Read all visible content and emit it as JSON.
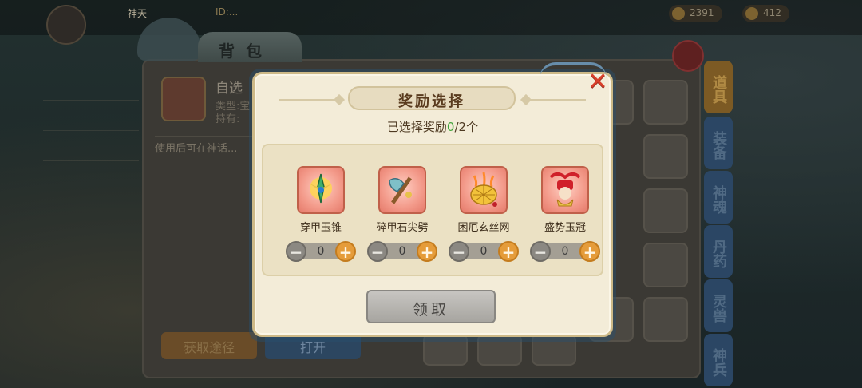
{
  "background": {
    "player_name": "神天",
    "player_id": "ID:...",
    "currencies": [
      "2391",
      "412"
    ],
    "bag_title": "背包",
    "item_detail": {
      "name": "自选",
      "type_label": "类型:宝",
      "holding_label": "持有:",
      "description": "使用后可在神话..."
    },
    "buttons": {
      "get_path": "获取途径",
      "open": "打开"
    },
    "side_tabs": [
      "道具",
      "装备",
      "神魂",
      "丹药",
      "灵兽",
      "神兵"
    ]
  },
  "modal": {
    "title": "奖励选择",
    "selected_prefix": "已选择奖励",
    "selected_count": "0",
    "selected_total": "/2个",
    "close_symbol": "✕",
    "claim_label": "领取",
    "rewards": [
      {
        "name": "穿甲玉锥",
        "quantity": "0",
        "icon": "jade-spike-icon"
      },
      {
        "name": "碎甲石尖劈",
        "quantity": "0",
        "icon": "stone-axe-icon"
      },
      {
        "name": "困厄玄丝网",
        "quantity": "0",
        "icon": "silk-net-icon"
      },
      {
        "name": "盛势玉冠",
        "quantity": "0",
        "icon": "jade-crown-icon"
      }
    ],
    "stepper_minus": "−",
    "stepper_plus": "+"
  },
  "colors": {
    "modal_bg": "#f3ecd8",
    "title_text": "#5a3c1f",
    "count_green": "#3fa43a",
    "plus_orange": "#e59c3a",
    "close_red": "#d8402b"
  }
}
